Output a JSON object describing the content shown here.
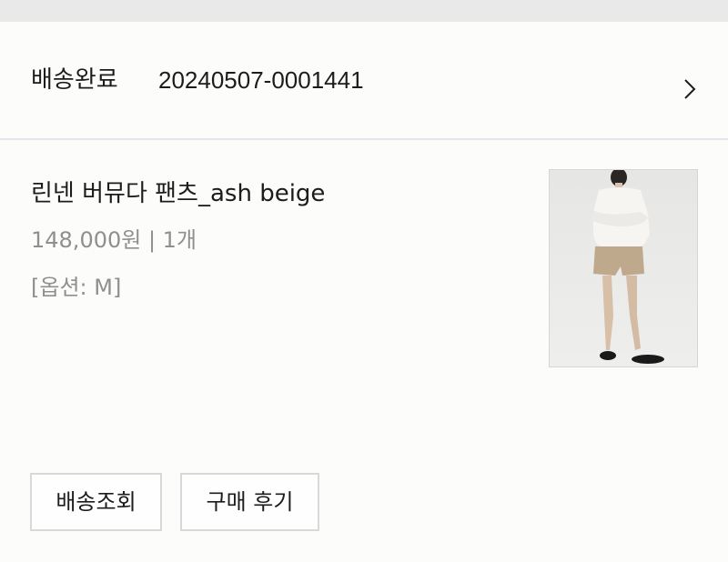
{
  "order": {
    "status": "배송완료",
    "number": "20240507-0001441"
  },
  "item": {
    "name": "린넨 버뮤다 팬츠_ash beige",
    "price_qty": "148,000원 | 1개",
    "option": "[옵션: M]",
    "image_icon": "product-photo"
  },
  "buttons": {
    "track": "배송조회",
    "review": "구매 후기"
  },
  "colors": {
    "background": "#fcfcfa",
    "muted_text": "#8f8f8f",
    "divider": "#e4e6ec"
  }
}
